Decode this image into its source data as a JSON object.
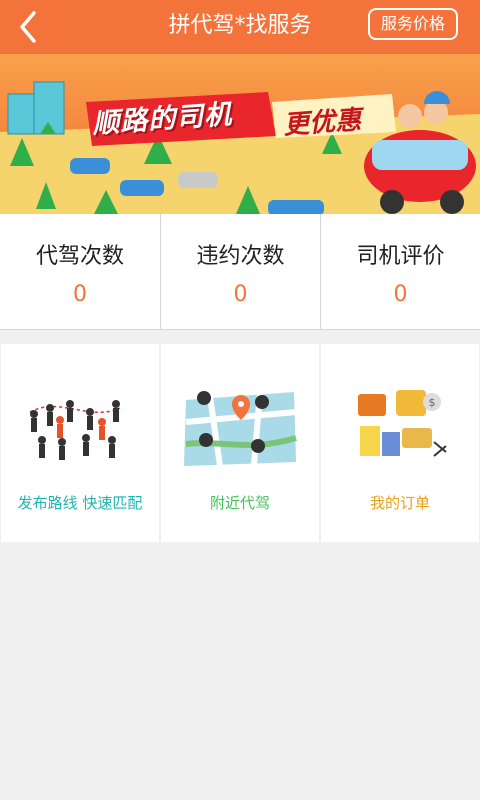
{
  "header": {
    "title": "拼代驾*找服务",
    "price_button": "服务价格",
    "back_icon": "chevron-left-icon"
  },
  "banner": {
    "slogan": "顺路的司机",
    "slogan_highlight": "更优惠"
  },
  "stats": [
    {
      "label": "代驾次数",
      "value": "0"
    },
    {
      "label": "违约次数",
      "value": "0"
    },
    {
      "label": "司机评价",
      "value": "0"
    }
  ],
  "menu": [
    {
      "label": "发布路线 快速匹配",
      "icon": "people-route-icon",
      "color": "#1fb6b0"
    },
    {
      "label": "附近代驾",
      "icon": "map-location-icon",
      "color": "#46c25a"
    },
    {
      "label": "我的订单",
      "icon": "shopping-orders-icon",
      "color": "#e8a317"
    }
  ],
  "colors": {
    "accent": "#f4733a",
    "stat_value": "#f4733a"
  }
}
